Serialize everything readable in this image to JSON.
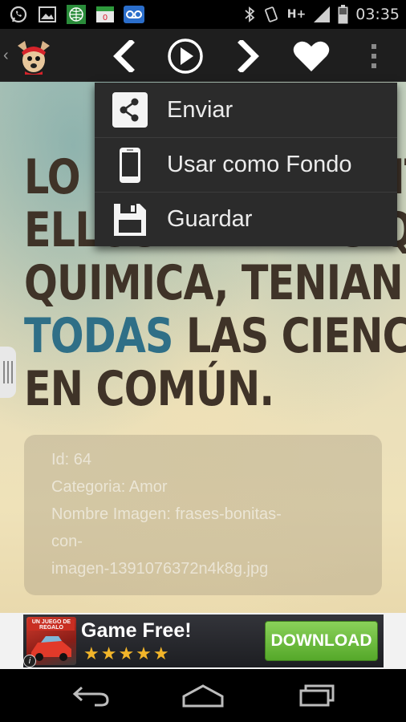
{
  "status_bar": {
    "icons_left": [
      "whatsapp-icon",
      "image-icon",
      "globe-icon",
      "calendar-icon",
      "voicemail-icon"
    ],
    "network_type": "H+",
    "time": "03:35"
  },
  "action_bar": {
    "icons": [
      "up-caret-icon",
      "app-logo",
      "previous-icon",
      "play-icon",
      "next-icon",
      "favorite-heart-icon",
      "overflow-menu-icon"
    ]
  },
  "content": {
    "quote_lines": [
      "LO QUE HABIA ENTRE",
      "ELLOS ERA MAS QUE",
      "QUIMICA, TENIAN"
    ],
    "quote_highlight": "TODAS",
    "quote_line4_rest": " LAS CIENCIAS",
    "quote_line5": "EN COMÚN.",
    "info": {
      "id_line": "Id: 64",
      "category_line": "Categoria: Amor",
      "name_line_1": "Nombre Imagen: frases-bonitas-",
      "name_line_2": "con-",
      "name_line_3": "imagen-1391076372n4k8g.jpg"
    }
  },
  "menu": {
    "items": [
      {
        "label": "Enviar",
        "icon": "share-icon"
      },
      {
        "label": "Usar como Fondo",
        "icon": "phone-icon"
      },
      {
        "label": "Guardar",
        "icon": "save-icon"
      }
    ]
  },
  "ad": {
    "thumb_label": "UN JUEGO DE REGALO",
    "title": "Game Free!",
    "stars": "★★★★★",
    "cta": "DOWNLOAD",
    "info_icon": "i"
  },
  "nav_bar": {
    "icons": [
      "back-icon",
      "home-icon",
      "recent-apps-icon"
    ]
  },
  "colors": {
    "quote_text": "#3f3328",
    "quote_highlight": "#2f6f87",
    "menu_bg": "#2b2b2b",
    "cta_green": "#55a82a"
  }
}
